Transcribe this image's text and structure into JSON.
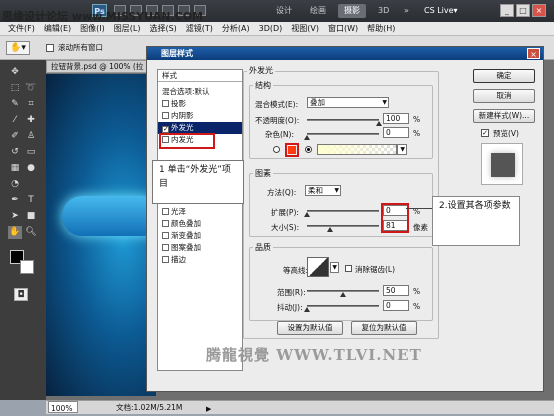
{
  "watermark_top": "思缘设计论坛 www.MISSYUAN.COM",
  "titlebar": {
    "logo": "Ps",
    "workspaces": [
      "设计",
      "绘画",
      "摄影",
      "3D",
      "»"
    ],
    "active_workspace": "摄影",
    "cslive": "CS Live▾"
  },
  "menu": [
    "文件(F)",
    "编辑(E)",
    "图像(I)",
    "图层(L)",
    "选择(S)",
    "滤镜(T)",
    "分析(A)",
    "3D(D)",
    "视图(V)",
    "窗口(W)",
    "帮助(H)"
  ],
  "options": {
    "scroll_all": "滚动所有窗口"
  },
  "document": {
    "tab": "拉钮背景.psd @ 100% (拉"
  },
  "status": {
    "zoom": "100%",
    "doc": "文档:1.02M/5.21M"
  },
  "dialog": {
    "title": "图层样式",
    "styles_header": "样式",
    "styles": [
      {
        "label": "混合选项:默认",
        "checkbox": false
      },
      {
        "label": "投影",
        "checkbox": true
      },
      {
        "label": "内阴影",
        "checkbox": true
      },
      {
        "label": "外发光",
        "checkbox": true,
        "checked": true,
        "selected": true
      },
      {
        "label": "内发光",
        "checkbox": true
      },
      {
        "label": "",
        "checkbox": false
      },
      {
        "label": "",
        "checkbox": false
      },
      {
        "label": "",
        "checkbox": false
      },
      {
        "label": "",
        "checkbox": false
      },
      {
        "label": "",
        "checkbox": false
      },
      {
        "label": "光泽",
        "checkbox": true
      },
      {
        "label": "颜色叠加",
        "checkbox": true
      },
      {
        "label": "渐变叠加",
        "checkbox": true
      },
      {
        "label": "图案叠加",
        "checkbox": true
      },
      {
        "label": "描边",
        "checkbox": true
      }
    ],
    "outer_glow_title": "外发光",
    "structure": {
      "title": "结构",
      "blend_mode_label": "混合模式(E):",
      "blend_mode": "叠加",
      "opacity_label": "不透明度(O):",
      "opacity": "100",
      "opacity_fraction": 1.0,
      "noise_label": "杂色(N):",
      "noise": "0",
      "noise_fraction": 0.0,
      "pct": "%",
      "color_swatch": "#ff3b10",
      "gradient_from": "#ffffd0"
    },
    "elements": {
      "title": "图素",
      "method_label": "方法(Q):",
      "method": "柔和",
      "spread_label": "扩展(P):",
      "spread": "0",
      "spread_fraction": 0.0,
      "size_label": "大小(S):",
      "size": "81",
      "size_fraction": 0.32,
      "pct": "%",
      "px": "像素"
    },
    "quality": {
      "title": "品质",
      "contour_label": "等高线:",
      "antialias_label": "消除锯齿(L)",
      "range_label": "范围(R):",
      "range": "50",
      "range_fraction": 0.5,
      "jitter_label": "抖动(J):",
      "jitter": "0",
      "jitter_fraction": 0.0,
      "pct": "%"
    },
    "buttons": {
      "ok": "确定",
      "cancel": "取消",
      "new_style": "新建样式(W)...",
      "preview": "预览(V)",
      "make_default": "设置为默认值",
      "reset_default": "复位为默认值"
    }
  },
  "callouts": {
    "step1": "1 单击“外发光”项目",
    "step2": "2.设置其各项参数"
  },
  "watermark_bottom": "腾龍視覺 WWW.TLVI.NET"
}
